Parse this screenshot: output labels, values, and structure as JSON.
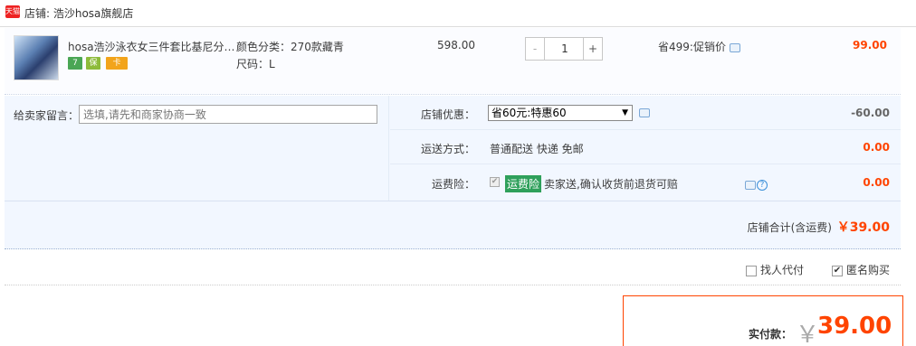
{
  "shop": {
    "badge": "天猫",
    "name": "店铺: 浩沙hosa旗舰店"
  },
  "item": {
    "title": "hosa浩沙泳衣女三件套比基尼分…",
    "tags": [
      "7",
      "保",
      "卡"
    ],
    "sku_color": "颜色分类：270款藏青",
    "sku_size": "尺码：L",
    "unit_price": "598.00",
    "quantity": "1",
    "qty_minus": "-",
    "qty_plus": "+",
    "discount": "省499:促销价",
    "total": "99.00"
  },
  "message": {
    "label": "给卖家留言：",
    "placeholder": "选填,请先和商家协商一致"
  },
  "shop_discount": {
    "label": "店铺优惠：",
    "selected": "省60元:特惠60",
    "amount": "-60.00"
  },
  "shipping": {
    "label": "运送方式：",
    "value": "普通配送 快递 免邮",
    "amount": "0.00"
  },
  "insurance": {
    "label": "运费险：",
    "tag": "运费险",
    "text": "卖家送,确认收货前退货可赔",
    "amount": "0.00",
    "help": "?"
  },
  "shop_total": {
    "label": "店铺合计(含运费)",
    "amount": "￥39.00"
  },
  "options": {
    "proxy_label": "找人代付",
    "anonymous_label": "匿名购买",
    "anonymous_checked": true
  },
  "payment": {
    "label": "实付款：",
    "yen": "￥",
    "amount": "39.00"
  }
}
